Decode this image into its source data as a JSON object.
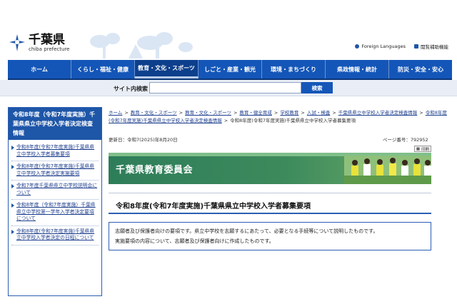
{
  "header": {
    "logo_main": "千葉県",
    "logo_sub": "chiba prefecture",
    "links": [
      {
        "label": "Foreign Languages"
      },
      {
        "label": "閲覧補助機能"
      }
    ]
  },
  "nav": {
    "items": [
      {
        "label": "ホーム"
      },
      {
        "label": "くらし・福祉・健康"
      },
      {
        "label": "教育・文化・スポーツ"
      },
      {
        "label": "しごと・産業・観光"
      },
      {
        "label": "環境・まちづくり"
      },
      {
        "label": "県政情報・統計"
      },
      {
        "label": "防災・安全・安心"
      }
    ],
    "active_index": 2
  },
  "search": {
    "label": "サイト内検索",
    "value": "",
    "button": "検索"
  },
  "sidebar": {
    "heading": "令和8年度（令和7年度実施）千葉県県立中学校入学者決定検査情報",
    "items": [
      {
        "label": "令和8年度(令和7年度実施)千葉県県立中学校入学者募集要項"
      },
      {
        "label": "令和8年度(令和7年度実施)千葉県県立中学校入学者決定実施要項"
      },
      {
        "label": "令和7年度千葉県県立中学校説明会について"
      },
      {
        "label": "令和8年度（令和7年度実施）千葉県県立中学校第一学年入学者決定要項について"
      },
      {
        "label": "令和8年度(令和7年度実施)千葉県県立中学校入学者決定の日程について"
      }
    ]
  },
  "breadcrumb": {
    "items": [
      {
        "label": "ホーム"
      },
      {
        "label": "教育・文化・スポーツ"
      },
      {
        "label": "教育・文化・スポーツ"
      },
      {
        "label": "教育・健全育成"
      },
      {
        "label": "学校教育"
      },
      {
        "label": "入試・検査"
      },
      {
        "label": "千葉県県立中学校入学者決定検査情報"
      },
      {
        "label": "令和8年度(令和7年度実施)千葉県県立中学校入学者決定検査情報"
      }
    ],
    "current": "令和8年度(令和7年度実施)千葉県県立中学校入学者募集要項"
  },
  "meta": {
    "updated": "更新日：令和7(2025)年8月20日",
    "page_number": "ページ番号：792952",
    "print_label": "印刷"
  },
  "banner": {
    "title": "千葉県教育委員会"
  },
  "main": {
    "title": "令和8年度(令和7年度実施)千葉県県立中学校入学者募集要項",
    "lead_lines": [
      "志願者及び保護者向けの要項です。県立中学校を志願するにあたって、必要となる手続等について説明したものです。",
      "実施要項の内容について、志願者及び保護者向けに作成したものです。"
    ]
  },
  "colors": {
    "nav_blue": "#1456b8",
    "nav_active": "#0d3f8c",
    "banner_green": "#2f7a58",
    "link_blue": "#1e3f8e"
  }
}
